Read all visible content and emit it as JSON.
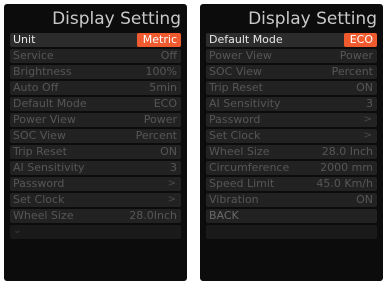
{
  "left_screen": {
    "title": "Display Setting",
    "rows": [
      {
        "label": "Unit",
        "value": "Metric"
      },
      {
        "label": "Service",
        "value": "Off"
      },
      {
        "label": "Brightness",
        "value": "100%"
      },
      {
        "label": "Auto Off",
        "value": "5min"
      },
      {
        "label": "Default Mode",
        "value": "ECO"
      },
      {
        "label": "Power View",
        "value": "Power"
      },
      {
        "label": "SOC View",
        "value": "Percent"
      },
      {
        "label": "Trip Reset",
        "value": "ON"
      },
      {
        "label": "AI Sensitivity",
        "value": "3"
      },
      {
        "label": "Password",
        "value": ">"
      },
      {
        "label": "Set Clock",
        "value": ">"
      },
      {
        "label": "Wheel Size",
        "value": "28.0Inch"
      }
    ],
    "more_indicator": "chevron-down-icon"
  },
  "right_screen": {
    "title": "Display Setting",
    "rows": [
      {
        "label": "Default Mode",
        "value": "ECO"
      },
      {
        "label": "Power View",
        "value": "Power"
      },
      {
        "label": "SOC View",
        "value": "Percent"
      },
      {
        "label": "Trip Reset",
        "value": "ON"
      },
      {
        "label": "AI Sensitivity",
        "value": "3"
      },
      {
        "label": "Password",
        "value": ">"
      },
      {
        "label": "Set Clock",
        "value": ">"
      },
      {
        "label": "Wheel Size",
        "value": "28.0 Inch"
      },
      {
        "label": "Circumference",
        "value": "2000 mm"
      },
      {
        "label": "Speed Limit",
        "value": "45.0 Km/h"
      },
      {
        "label": "Vibration",
        "value": "ON"
      },
      {
        "label": "BACK",
        "value": ""
      }
    ]
  },
  "colors": {
    "accent": "#ef5a2e",
    "screen_bg": "#0c0c0c",
    "row_bg": "#222222",
    "dim_text": "#565656",
    "title_text": "#c9c9c9"
  }
}
